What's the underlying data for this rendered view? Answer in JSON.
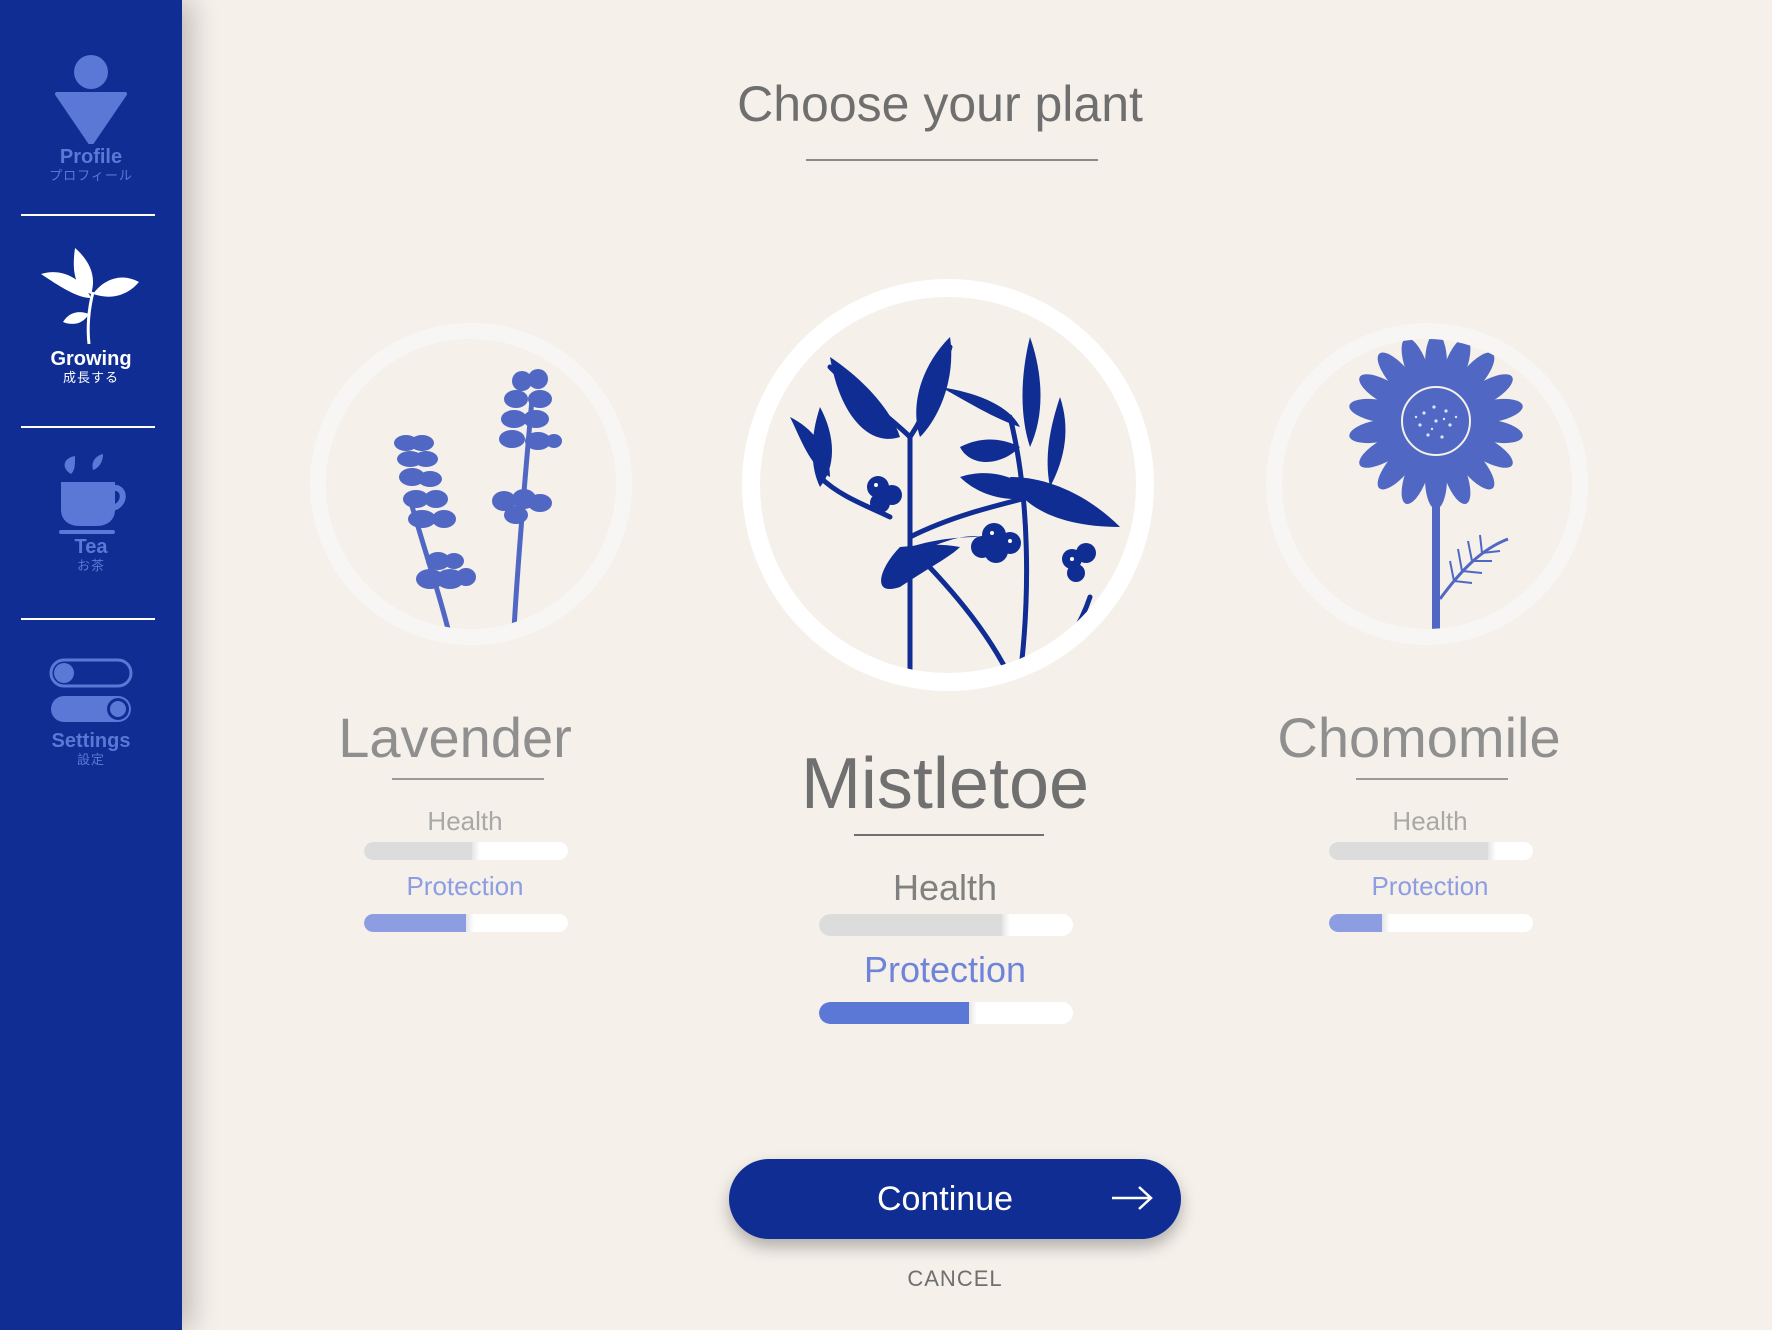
{
  "sidebar": {
    "items": [
      {
        "label": "Profile",
        "sub": "プロフィール",
        "icon": "profile-icon"
      },
      {
        "label": "Growing",
        "sub": "成長する",
        "icon": "sprout-icon",
        "active": true
      },
      {
        "label": "Tea",
        "sub": "お茶",
        "icon": "tea-cup-icon"
      },
      {
        "label": "Settings",
        "sub": "設定",
        "icon": "toggle-settings-icon"
      }
    ]
  },
  "page": {
    "title": "Choose your plant"
  },
  "plants": [
    {
      "name": "Lavender",
      "health_label": "Health",
      "protection_label": "Protection",
      "health": 0.53,
      "protection": 0.5
    },
    {
      "name": "Mistletoe",
      "health_label": "Health",
      "protection_label": "Protection",
      "health": 0.72,
      "protection": 0.59,
      "selected": true
    },
    {
      "name": "Chomomile",
      "health_label": "Health",
      "protection_label": "Protection",
      "health": 0.78,
      "protection": 0.26
    }
  ],
  "actions": {
    "continue_label": "Continue",
    "cancel_label": "CANCEL"
  },
  "colors": {
    "sidebar_bg": "#0f2d93",
    "page_bg": "#f5f0ea",
    "accent_blue": "#0f2d93",
    "plant_blue": "#5068c3",
    "protection_text": "#8c9de2",
    "protection_fill_dim": "#8c9de2",
    "protection_fill_active": "#5b78d6",
    "health_fill": "#dcdcdc"
  }
}
